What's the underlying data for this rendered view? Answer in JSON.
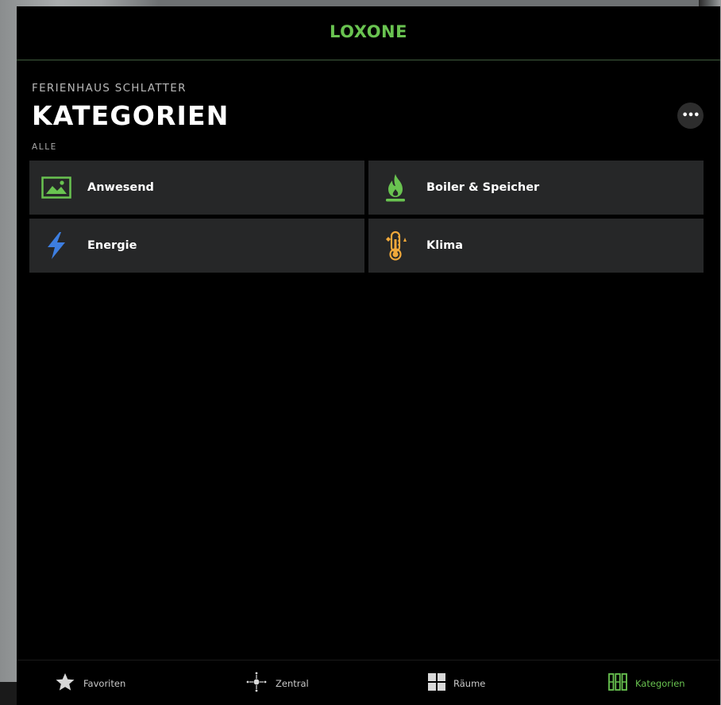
{
  "header": {
    "logo": "LOXONE"
  },
  "page": {
    "house_name": "FERIENHAUS SCHLATTER",
    "title": "KATEGORIEN",
    "filter_label": "ALLE",
    "more_label": "•••"
  },
  "categories": [
    {
      "label": "Anwesend",
      "icon": "landscape-image-icon",
      "color": "#69c350"
    },
    {
      "label": "Boiler & Speicher",
      "icon": "flame-icon",
      "color": "#69c350"
    },
    {
      "label": "Energie",
      "icon": "lightning-bolt-icon",
      "color": "#3d7ee0"
    },
    {
      "label": "Klima",
      "icon": "thermometer-icon",
      "color": "#f0a83a"
    }
  ],
  "tabs": [
    {
      "label": "Favoriten",
      "icon": "star-icon",
      "active": false
    },
    {
      "label": "Zentral",
      "icon": "central-hub-icon",
      "active": false
    },
    {
      "label": "Räume",
      "icon": "rooms-grid-icon",
      "active": false
    },
    {
      "label": "Kategorien",
      "icon": "categories-icon",
      "active": true
    }
  ],
  "colors": {
    "accent": "#69c350",
    "tile_bg": "#262728",
    "background": "#000000"
  }
}
